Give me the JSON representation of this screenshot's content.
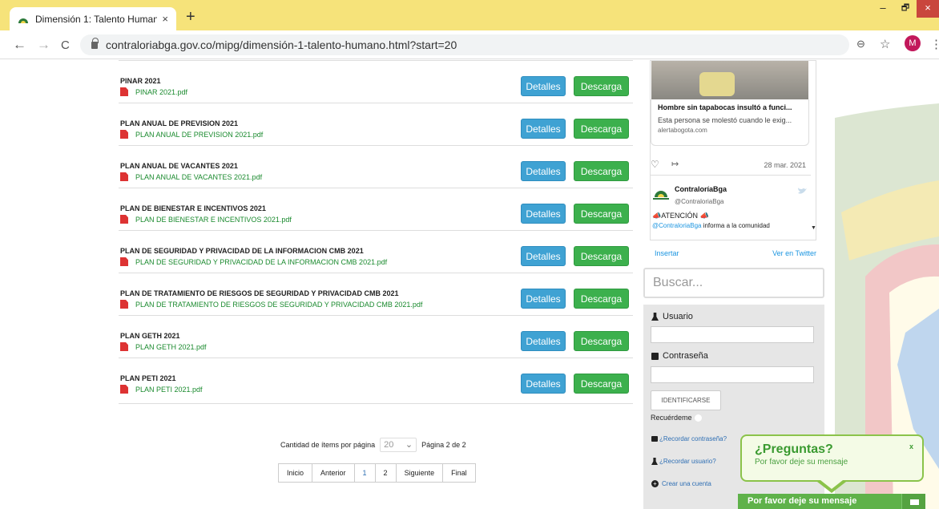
{
  "browser": {
    "tab_title": "Dimensión 1: Talento Humano",
    "tab_close": "×",
    "new_tab": "+",
    "url": "contraloriabga.gov.co/mipg/dimensión-1-talento-humano.html?start=20",
    "back": "←",
    "forward": "→",
    "reload": "C",
    "zoom_icon": "⊖",
    "star_icon": "☆",
    "avatar_letter": "M",
    "menu_icon": "⋮",
    "min": "–",
    "max": "🗗",
    "close": "×"
  },
  "documents": [
    {
      "name": "PINAR 2021",
      "file": "PINAR 2021.pdf"
    },
    {
      "name": "PLAN ANUAL DE PREVISION 2021",
      "file": "PLAN ANUAL DE PREVISION 2021.pdf"
    },
    {
      "name": "PLAN ANUAL DE VACANTES 2021",
      "file": "PLAN ANUAL DE VACANTES 2021.pdf"
    },
    {
      "name": "PLAN DE BIENESTAR E INCENTIVOS 2021",
      "file": "PLAN DE BIENESTAR E INCENTIVOS 2021.pdf"
    },
    {
      "name": "PLAN DE SEGURIDAD Y PRIVACIDAD DE LA INFORMACION CMB 2021",
      "file": "PLAN DE SEGURIDAD Y PRIVACIDAD DE LA INFORMACION CMB 2021.pdf"
    },
    {
      "name": "PLAN DE TRATAMIENTO DE RIESGOS DE SEGURIDAD Y PRIVACIDAD CMB 2021",
      "file": "PLAN DE TRATAMIENTO DE RIESGOS DE SEGURIDAD Y PRIVACIDAD CMB 2021.pdf"
    },
    {
      "name": "PLAN GETH 2021",
      "file": "PLAN GETH 2021.pdf"
    },
    {
      "name": "PLAN PETI 2021",
      "file": "PLAN PETI 2021.pdf"
    }
  ],
  "buttons": {
    "details": "Detalles",
    "download": "Descarga"
  },
  "pagination": {
    "items_label": "Cantidad de ítems por página",
    "items_value": "20",
    "page_info": "Página 2 de 2",
    "pages": [
      "Inicio",
      "Anterior",
      "1",
      "2",
      "Siguiente",
      "Final"
    ]
  },
  "twitter": {
    "card_title": "Hombre sin tapabocas insultó a funci...",
    "card_desc": "Esta persona se molestó cuando le exig...",
    "card_url": "alertabogota.com",
    "heart": "♡",
    "share": "↦",
    "date": "28 mar. 2021",
    "author": "ContraloríaBga",
    "handle": "@ContraloriaBga",
    "attention": "📣ATENCIÓN 📣",
    "mention": "@ContraloriaBga",
    "body": " informa a la comunidad",
    "insert": "Insertar",
    "view": "Ver en Twitter"
  },
  "search": {
    "placeholder": "Buscar..."
  },
  "login": {
    "user_label": "Usuario",
    "password_label": "Contraseña",
    "submit": "IDENTIFICARSE",
    "remember": "Recuérdeme",
    "forgot_password": "¿Recordar contraseña?",
    "forgot_user": "¿Recordar usuario?",
    "create": "Crear una cuenta"
  },
  "chat": {
    "title": "¿Preguntas?",
    "subtitle": "Por favor deje su mensaje",
    "close": "x",
    "bar": "Por favor deje su mensaje"
  },
  "colors": {
    "tabbar": "#f6e37a",
    "details": "#3fa2d3",
    "download": "#3cb04d",
    "link_green": "#1a8a2e",
    "chat_green": "#5fb24a"
  }
}
